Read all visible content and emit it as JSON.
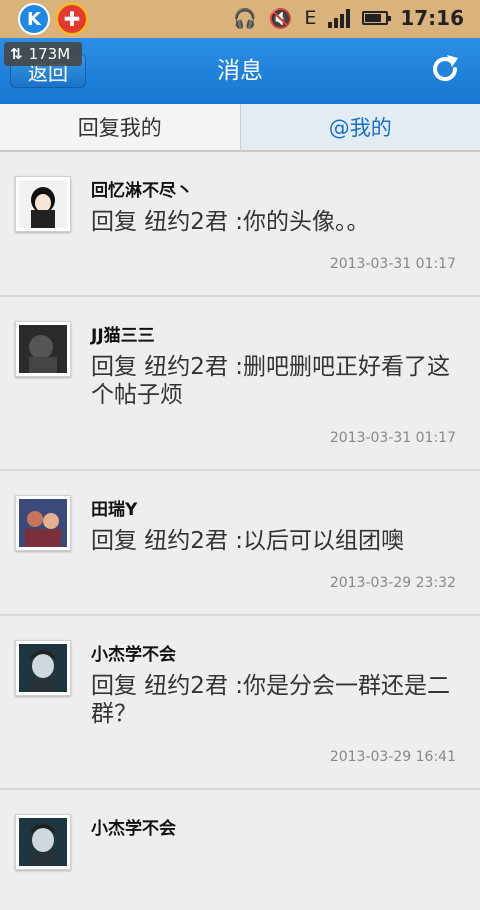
{
  "status": {
    "time": "17:16",
    "net_letter": "E"
  },
  "traffic": {
    "value": "173M"
  },
  "header": {
    "back_label": "返回",
    "title": "消息"
  },
  "tabs": [
    {
      "label": "回复我的",
      "active": false
    },
    {
      "label": "@我的",
      "active": true
    }
  ],
  "messages": [
    {
      "user": "回忆淋不尽丶",
      "text": "回复 纽约2君 :你的头像。。",
      "time": "2013-03-31 01:17"
    },
    {
      "user": "JJ猫三三",
      "text": "回复 纽约2君 :删吧删吧正好看了这个帖子烦",
      "time": "2013-03-31 01:17"
    },
    {
      "user": "田瑞Y",
      "text": "回复 纽约2君 :以后可以组团噢",
      "time": "2013-03-29 23:32"
    },
    {
      "user": "小杰学不会",
      "text": "回复 纽约2君 :你是分会一群还是二群？",
      "time": "2013-03-29 16:41"
    },
    {
      "user": "小杰学不会",
      "text": "",
      "time": ""
    }
  ],
  "colors": {
    "header": "#1877d2",
    "tab_active_text": "#1a6fc7",
    "status_bar": "#d9b27c"
  }
}
